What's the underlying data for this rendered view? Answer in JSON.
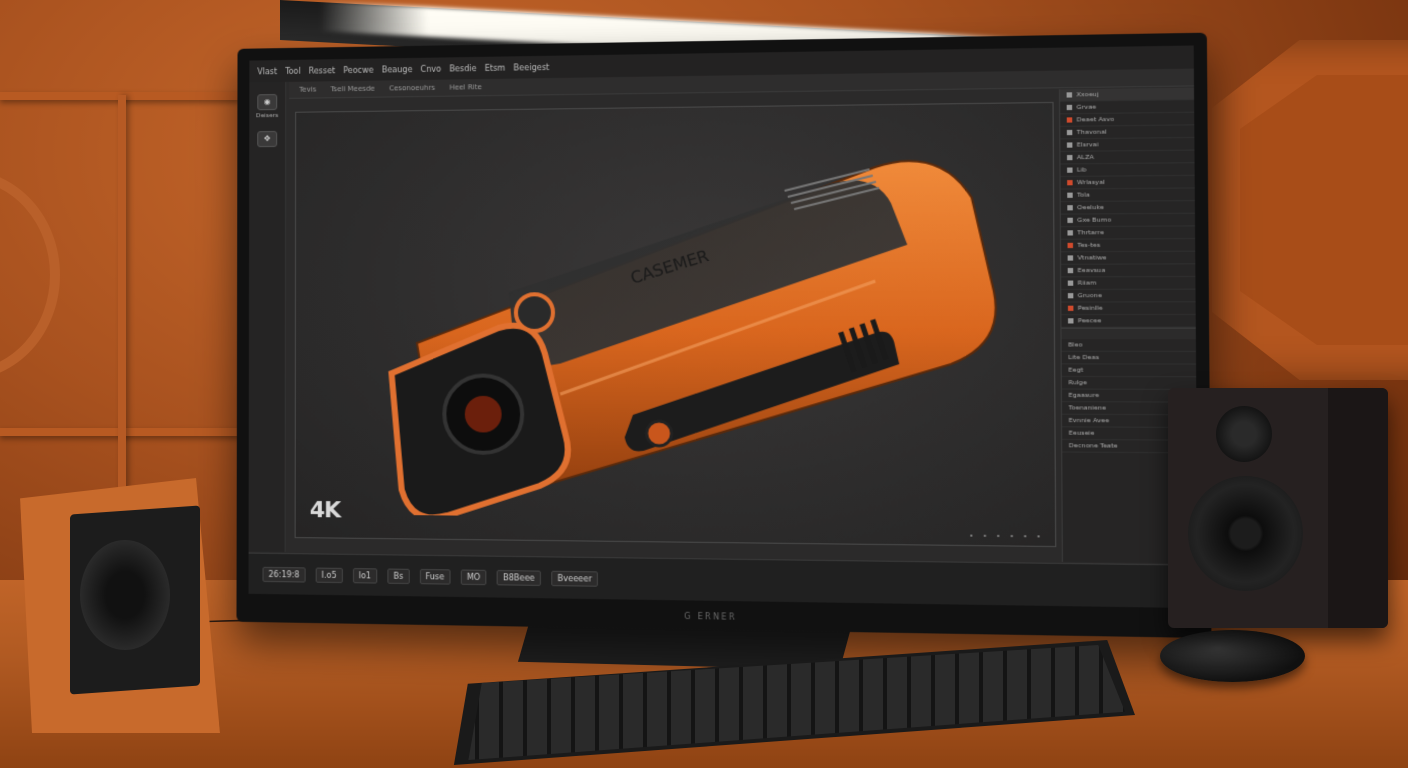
{
  "app": {
    "menu": [
      "Vlast",
      "Tool",
      "Resset",
      "Peocwe",
      "Beauge",
      "Cnvo",
      "Besdie",
      "Etsm",
      "Beeigest"
    ],
    "toolbar": [
      "Tevis",
      "Tseli Meesde",
      "Cesonoeuhrs",
      "Heel Rite"
    ],
    "left_tools": [
      {
        "label": "Deisers",
        "icon": "camera-icon"
      },
      {
        "label": "",
        "icon": "move-icon"
      }
    ]
  },
  "viewport": {
    "badge": "4K",
    "model_label": "CASEMER"
  },
  "right_panel": {
    "rows": [
      "Xxoeuj",
      "Grvae",
      "Deaet Asvo",
      "Thavonal",
      "Elsrvai",
      "ALZA",
      "Lib",
      "Wrlasyal",
      "Tola",
      "Oeeluke",
      "Gxe Bumo",
      "Thrtarre",
      "Tes-tes",
      "Vtnatiwe",
      "Eeavsua",
      "Riiam",
      "Gruone",
      "Pesinlle",
      "Peecee"
    ],
    "properties": [
      "Bleo",
      "Lite Deas",
      "Eegt",
      "Rulge",
      "Egaasure",
      "Toenaniene",
      "Evnnie Avee",
      "Eeuseie",
      "Decnone Teate"
    ]
  },
  "timeline": {
    "frame": "26:19:8",
    "items": [
      "I.o5",
      "lo1",
      "Bs",
      "Fuse",
      "MO",
      "B8Beee",
      "Bveeeer"
    ]
  },
  "monitor": {
    "brand": "G ERNER"
  },
  "colors": {
    "accent": "#e8732a",
    "panel": "#262525"
  }
}
